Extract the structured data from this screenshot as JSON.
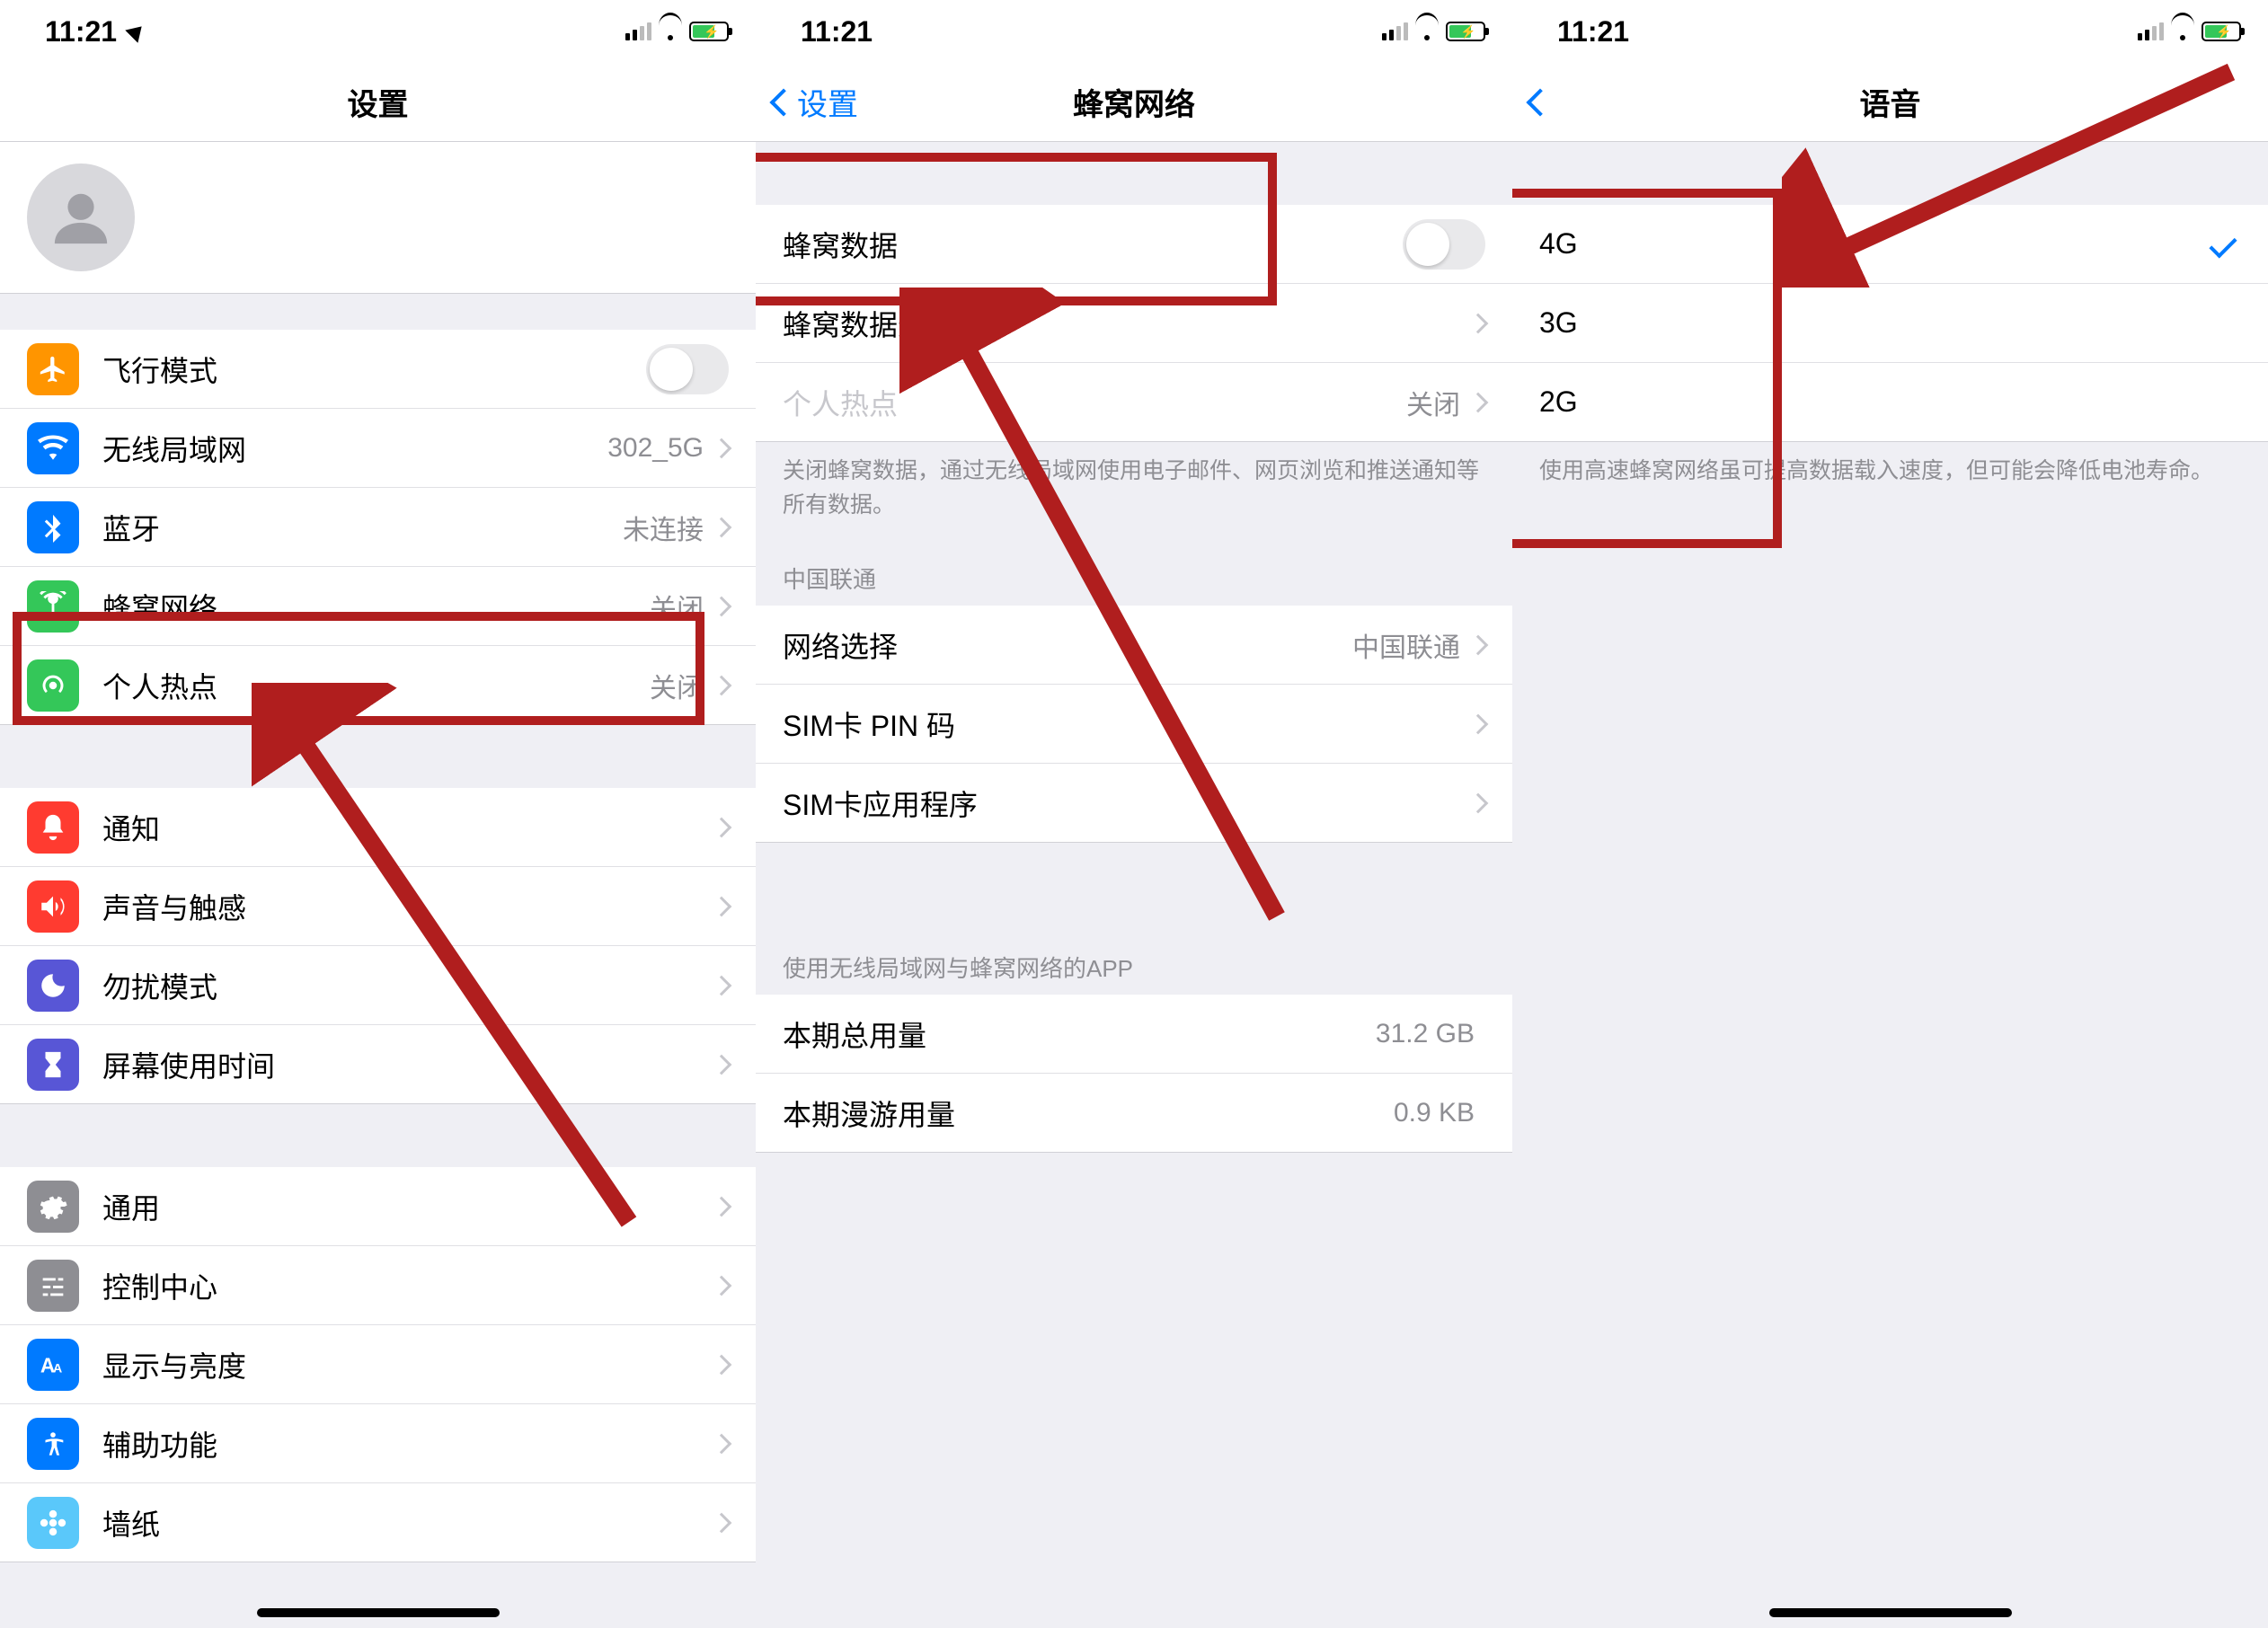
{
  "status": {
    "time": "11:21"
  },
  "pane1": {
    "title": "设置",
    "rows1": [
      {
        "label": "飞行模式",
        "icon": "airplane",
        "color": "bg-orange",
        "type": "toggle"
      },
      {
        "label": "无线局域网",
        "icon": "wifi",
        "color": "bg-blue",
        "detail": "302_5G",
        "type": "link"
      },
      {
        "label": "蓝牙",
        "icon": "bluetooth",
        "color": "bg-blue",
        "detail": "未连接",
        "type": "link"
      },
      {
        "label": "蜂窝网络",
        "icon": "antenna",
        "color": "bg-green",
        "detail": "关闭",
        "type": "link"
      },
      {
        "label": "个人热点",
        "icon": "hotspot",
        "color": "bg-green",
        "detail": "关闭",
        "type": "link"
      }
    ],
    "rows2": [
      {
        "label": "通知",
        "icon": "bell",
        "color": "bg-red",
        "type": "link"
      },
      {
        "label": "声音与触感",
        "icon": "speaker",
        "color": "bg-red",
        "type": "link"
      },
      {
        "label": "勿扰模式",
        "icon": "moon",
        "color": "bg-purple",
        "type": "link"
      },
      {
        "label": "屏幕使用时间",
        "icon": "hourglass",
        "color": "bg-purple",
        "type": "link"
      }
    ],
    "rows3": [
      {
        "label": "通用",
        "icon": "gear",
        "color": "bg-grey",
        "type": "link"
      },
      {
        "label": "控制中心",
        "icon": "sliders",
        "color": "bg-grey",
        "type": "link"
      },
      {
        "label": "显示与亮度",
        "icon": "aa",
        "color": "bg-blue",
        "type": "link"
      },
      {
        "label": "辅助功能",
        "icon": "access",
        "color": "bg-blue",
        "type": "link"
      },
      {
        "label": "墙纸",
        "icon": "flower",
        "color": "bg-teal",
        "type": "link"
      }
    ]
  },
  "pane2": {
    "back": "设置",
    "title": "蜂窝网络",
    "sec1": [
      {
        "label": "蜂窝数据",
        "type": "toggle"
      },
      {
        "label": "蜂窝数据选项",
        "type": "link"
      },
      {
        "label": "个人热点",
        "type": "link",
        "detail": "关闭",
        "disabled": true
      }
    ],
    "note1": "关闭蜂窝数据，通过无线局域网使用电子邮件、网页浏览和推送通知等所有数据。",
    "header2": "中国联通",
    "sec2": [
      {
        "label": "网络选择",
        "type": "link",
        "detail": "中国联通"
      },
      {
        "label": "SIM卡 PIN 码",
        "type": "link"
      },
      {
        "label": "SIM卡应用程序",
        "type": "link"
      }
    ],
    "header3": "使用无线局域网与蜂窝网络的APP",
    "sec3": [
      {
        "label": "本期总用量",
        "detail": "31.2 GB"
      },
      {
        "label": "本期漫游用量",
        "detail": "0.9 KB"
      }
    ]
  },
  "pane3": {
    "title": "语音",
    "rows": [
      {
        "label": "4G",
        "checked": true
      },
      {
        "label": "3G"
      },
      {
        "label": "2G"
      }
    ],
    "note": "使用高速蜂窝网络虽可提高数据载入速度，但可能会降低电池寿命。"
  }
}
